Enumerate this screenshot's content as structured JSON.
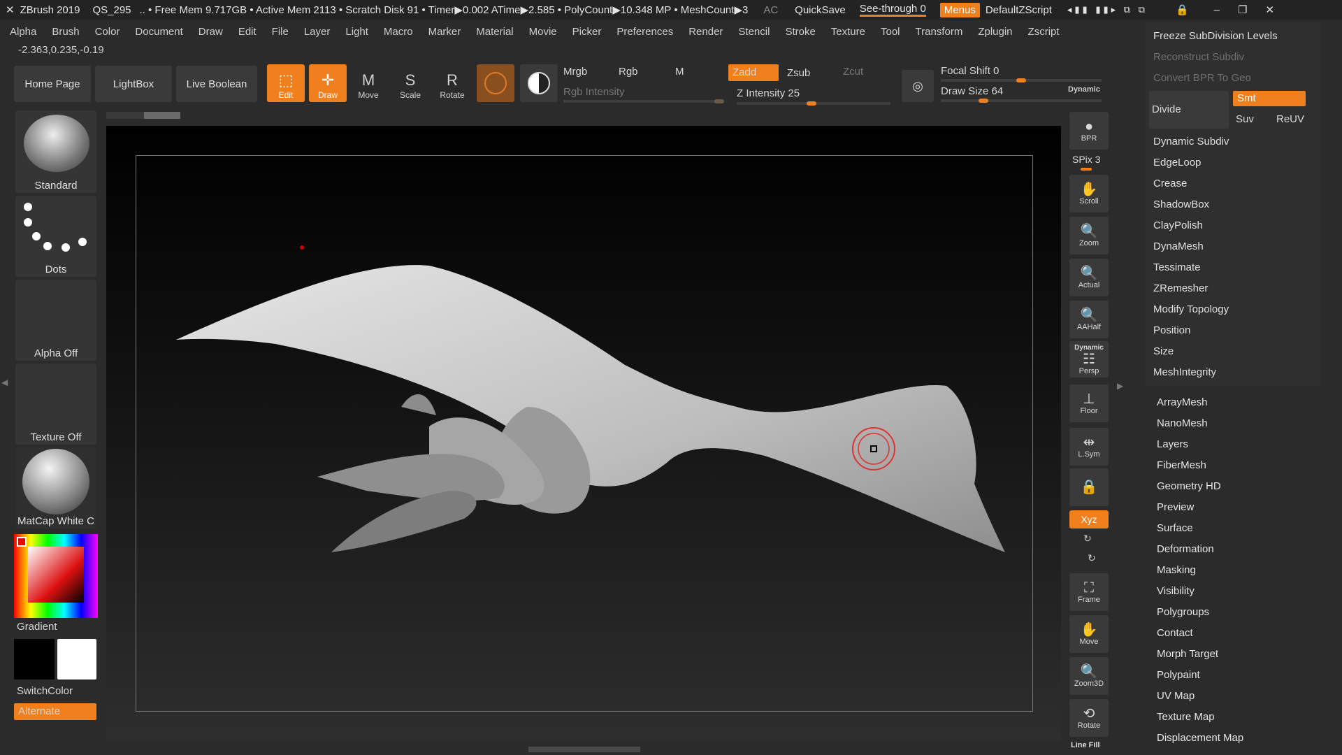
{
  "titlebar": {
    "app": "ZBrush 2019",
    "project": "QS_295",
    "status": ".. • Free Mem 9.717GB • Active Mem 2113 • Scratch Disk 91 • Timer▶0.002 ATime▶2.585 • PolyCount▶10.348 MP • MeshCount▶3",
    "ac": "AC",
    "quicksave": "QuickSave",
    "seethrough": "See-through  0",
    "menus": "Menus",
    "script": "DefaultZScript"
  },
  "menubar": [
    "Alpha",
    "Brush",
    "Color",
    "Document",
    "Draw",
    "Edit",
    "File",
    "Layer",
    "Light",
    "Macro",
    "Marker",
    "Material",
    "Movie",
    "Picker",
    "Preferences",
    "Render",
    "Stencil",
    "Stroke",
    "Texture",
    "Tool",
    "Transform",
    "Zplugin",
    "Zscript"
  ],
  "coords": "-2.363,0.235,-0.19",
  "shelf": {
    "home": "Home Page",
    "lightbox": "LightBox",
    "liveboolean": "Live Boolean",
    "tools": [
      "Edit",
      "Draw",
      "Move",
      "Scale",
      "Rotate"
    ],
    "mrgb": "Mrgb",
    "rgb": "Rgb",
    "m": "M",
    "zadd": "Zadd",
    "zsub": "Zsub",
    "zcut": "Zcut",
    "rgb_intensity": "Rgb Intensity",
    "z_intensity_label": "Z Intensity",
    "z_intensity": 25,
    "focal_label": "Focal Shift",
    "focal": 0,
    "drawsize_label": "Draw Size",
    "drawsize": 64,
    "dynamic": "Dynamic"
  },
  "left": {
    "brush": "Standard",
    "stroke": "Dots",
    "alpha": "Alpha Off",
    "texture": "Texture Off",
    "material": "MatCap White C",
    "gradient": "Gradient",
    "switchcolor": "SwitchColor",
    "alternate": "Alternate"
  },
  "right_toolbar": {
    "bpr": "BPR",
    "spix": "SPix 3",
    "buttons": [
      "Scroll",
      "Zoom",
      "Actual",
      "AAHalf",
      "Persp",
      "Floor",
      "L.Sym",
      "",
      "Frame",
      "Move",
      "Zoom3D",
      "Rotate"
    ],
    "persp_top": "Dynamic",
    "xyz": "Xyz",
    "linefill": "Line Fill"
  },
  "palette": {
    "freeze": "Freeze SubDivision Levels",
    "reconstruct": "Reconstruct Subdiv",
    "convert": "Convert BPR To Geo",
    "divide": "Divide",
    "smt": "Smt",
    "suv": "Suv",
    "reuv": "ReUV",
    "items": [
      "Dynamic Subdiv",
      "EdgeLoop",
      "Crease",
      "ShadowBox",
      "ClayPolish",
      "DynaMesh",
      "Tessimate",
      "ZRemesher",
      "Modify Topology",
      "Position",
      "Size",
      "MeshIntegrity"
    ],
    "sections": [
      "ArrayMesh",
      "NanoMesh",
      "Layers",
      "FiberMesh",
      "Geometry HD",
      "Preview",
      "Surface",
      "Deformation",
      "Masking",
      "Visibility",
      "Polygroups",
      "Contact",
      "Morph Target",
      "Polypaint",
      "UV Map",
      "Texture Map",
      "Displacement Map"
    ]
  },
  "colors": {
    "accent": "#f0801e",
    "bg": "#2b2b2b",
    "panel": "#353535"
  }
}
